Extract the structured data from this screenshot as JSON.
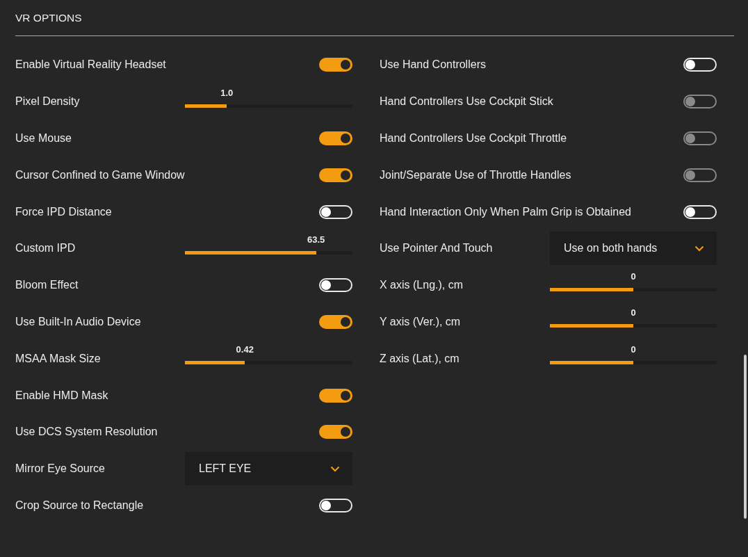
{
  "section": {
    "title": "VR OPTIONS"
  },
  "left_settings": [
    {
      "kind": "toggle",
      "label": "Enable Virtual Reality Headset",
      "on": true,
      "disabled": false
    },
    {
      "kind": "slider",
      "label": "Pixel Density",
      "level": 0.25,
      "reading": "1.0"
    },
    {
      "kind": "toggle",
      "label": "Use Mouse",
      "on": true,
      "disabled": false
    },
    {
      "kind": "toggle",
      "label": "Cursor Confined to Game Window",
      "on": true,
      "disabled": false
    },
    {
      "kind": "toggle",
      "label": "Force IPD Distance",
      "on": false,
      "disabled": false
    },
    {
      "kind": "slider",
      "label": "Custom IPD",
      "level": 0.783,
      "reading": "63.5"
    },
    {
      "kind": "toggle",
      "label": "Bloom Effect",
      "on": false,
      "disabled": false
    },
    {
      "kind": "toggle",
      "label": "Use Built-In Audio Device",
      "on": true,
      "disabled": false
    },
    {
      "kind": "slider",
      "label": "MSAA Mask Size",
      "level": 0.358,
      "reading": "0.42"
    },
    {
      "kind": "toggle",
      "label": "Enable HMD Mask",
      "on": true,
      "disabled": false
    },
    {
      "kind": "toggle",
      "label": "Use DCS System Resolution",
      "on": true,
      "disabled": false
    },
    {
      "kind": "dropdown",
      "label": "Mirror Eye Source",
      "value": "LEFT EYE"
    },
    {
      "kind": "toggle",
      "label": "Crop Source to Rectangle",
      "on": false,
      "disabled": false
    }
  ],
  "right_settings": [
    {
      "kind": "toggle",
      "label": "Use Hand Controllers",
      "on": false,
      "disabled": false
    },
    {
      "kind": "toggle",
      "label": "Hand Controllers Use Cockpit Stick",
      "on": false,
      "disabled": true
    },
    {
      "kind": "toggle",
      "label": "Hand Controllers Use Cockpit Throttle",
      "on": false,
      "disabled": true
    },
    {
      "kind": "toggle",
      "label": "Joint/Separate Use of Throttle Handles",
      "on": false,
      "disabled": true
    },
    {
      "kind": "toggle",
      "label": "Hand Interaction Only When Palm Grip is Obtained",
      "on": false,
      "disabled": false
    },
    {
      "kind": "dropdown",
      "label": "Use Pointer And Touch",
      "value": "Use on both hands"
    },
    {
      "kind": "slider",
      "label": "X axis (Lng.), cm",
      "level": 0.5,
      "reading": "0"
    },
    {
      "kind": "slider",
      "label": "Y axis (Ver.), cm",
      "level": 0.5,
      "reading": "0"
    },
    {
      "kind": "slider",
      "label": "Z axis (Lat.), cm",
      "level": 0.5,
      "reading": "0"
    }
  ]
}
